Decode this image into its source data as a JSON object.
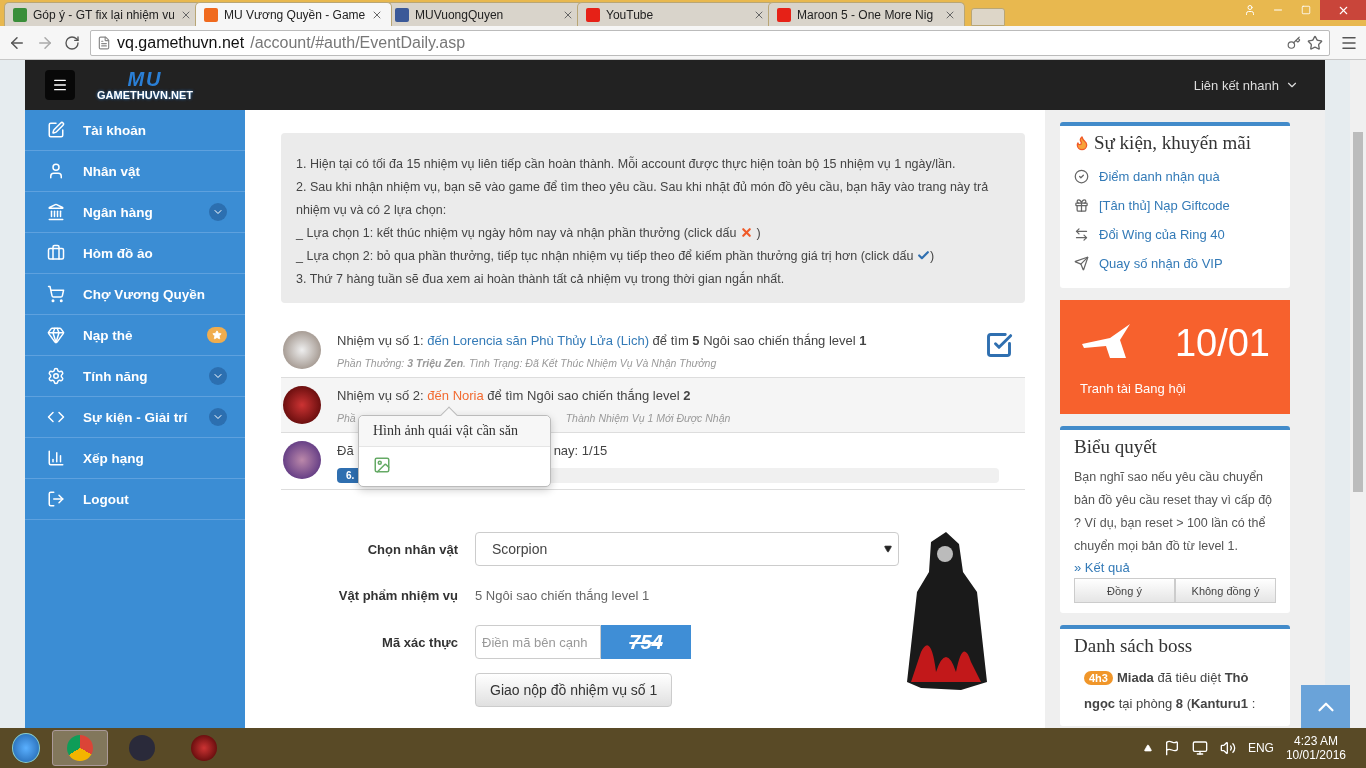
{
  "browser": {
    "tabs": [
      {
        "kind": "g",
        "title": "Góp ý - GT fix lại nhiệm vu",
        "selected": false
      },
      {
        "kind": "crown",
        "title": "MU Vương Quyền - Game",
        "selected": true
      },
      {
        "kind": "fb",
        "title": "MUVuongQuyen",
        "selected": false
      },
      {
        "kind": "yt",
        "title": "YouTube",
        "selected": false
      },
      {
        "kind": "yt",
        "title": "Maroon 5 - One More Nig",
        "selected": false
      }
    ],
    "url_host": "vq.gamethuvn.net",
    "url_path": "/account/#auth/EventDaily.asp"
  },
  "navbar": {
    "logo_big": "MU",
    "logo": "GAMETHUVN.NET",
    "quick_links": "Liên kết nhanh"
  },
  "sidebar": {
    "items": [
      {
        "label": "Tài khoản"
      },
      {
        "label": "Nhân vật"
      },
      {
        "label": "Ngân hàng"
      },
      {
        "label": "Hòm đồ ảo"
      },
      {
        "label": "Chợ Vương Quyền"
      },
      {
        "label": "Nạp thẻ"
      },
      {
        "label": "Tính năng"
      },
      {
        "label": "Sự kiện - Giải trí"
      },
      {
        "label": "Xếp hạng"
      },
      {
        "label": "Logout"
      }
    ]
  },
  "notice": [
    {
      "kind": "plain",
      "text": "1. Hiện tại có tối đa 15 nhiệm vụ liên tiếp cần hoàn thành. Mỗi account được thực hiện toàn bộ 15 nhiệm vụ 1 ngày/lần."
    },
    {
      "kind": "plain",
      "text": "2. Sau khi nhận nhiệm vụ, bạn sẽ vào game để tìm theo yêu cầu. Sau khi nhặt đủ món đồ yêu cầu, bạn hãy vào trang này trả nhiệm vụ và có 2 lựa chọn:"
    },
    {
      "kind": "cross",
      "text": "_ Lựa chọn 1: kết thúc nhiệm vụ ngày hôm nay và nhận phần thưởng (click dấu",
      "close": ")"
    },
    {
      "kind": "check",
      "text": "_ Lựa chọn 2: bỏ qua phần thưởng, tiếp tục nhận nhiệm vụ tiếp theo để kiếm phần thưởng giá trị hơn (click dấu",
      "close": ")"
    },
    {
      "kind": "plain",
      "text": "3. Thứ 7 hàng tuần sẽ đua xem ai hoàn thành tất cả nhiệm vụ trong thời gian ngắn nhất."
    }
  ],
  "missions": [
    {
      "kind": "done",
      "prefix": "Nhiệm vụ số 1:",
      "link": "đến Lorencia săn Phù Thủy Lửa (Lich)",
      "suffix": "để tìm **5** Ngôi sao chiến thắng level **1**",
      "meta": "Phần Thưởng: **3 Triệu Zen**. Tình Trạng: Đã Kết Thúc Nhiệm Vụ Và Nhận Thưởng",
      "checked": true
    },
    {
      "kind": "current",
      "prefix": "Nhiệm vụ số 2:",
      "link": "đến Noria",
      "suffix": "để tìm Ngôi sao chiến thắng level **2**",
      "meta_start": "Phầ",
      "meta_end": "Thành Nhiệm Vụ 1 Mới Được Nhận"
    },
    {
      "kind": "progress",
      "text_start": "Đã",
      "text_end": "nay: 1/15",
      "bar_label": "6.",
      "level": 0.045
    }
  ],
  "popover": {
    "title": "Hình ảnh quái vật cần săn"
  },
  "form": {
    "character_label": "Chọn nhân vật",
    "character": "Scorpion",
    "item_label": "Vật phẩm nhiệm vụ",
    "item": "5 Ngôi sao chiến thắng level 1",
    "captcha_label": "Mã xác thực",
    "captcha_placeholder": "Điền mã bên cạnh",
    "captcha": "754",
    "submit": "Giao nộp đồ nhiệm vụ số 1"
  },
  "events": {
    "title": "Sự kiện, khuyến mãi",
    "links": [
      "Điểm danh nhận quà",
      "[Tân thủ] Nạp Giftcode",
      "Đổi Wing của Ring 40",
      "Quay số nhận đồ VIP"
    ]
  },
  "guild_card": {
    "date": "10/01",
    "label": "Tranh tài Bang hội"
  },
  "poll": {
    "title": "Biểu quyết",
    "question": "Bạn nghĩ sao nếu yêu cầu chuyển bản đồ yêu cầu reset thay vì cấp độ ? Ví dụ, bạn reset > 100 lần có thể chuyển mọi bản đồ từ level 1.",
    "results": "» Kết quả",
    "buttons": [
      "Đồng ý",
      "Không đồng ý"
    ]
  },
  "bosses": {
    "title": "Danh sách boss",
    "entries": [
      {
        "time": "4h3",
        "text": "**Miada** đã tiêu diệt **Thỏ ngọc** tại phòng **8** (**Kanturu1** :"
      }
    ]
  },
  "taskbar": {
    "language": "ENG",
    "time": "4:23 AM",
    "date": "10/01/2016"
  }
}
